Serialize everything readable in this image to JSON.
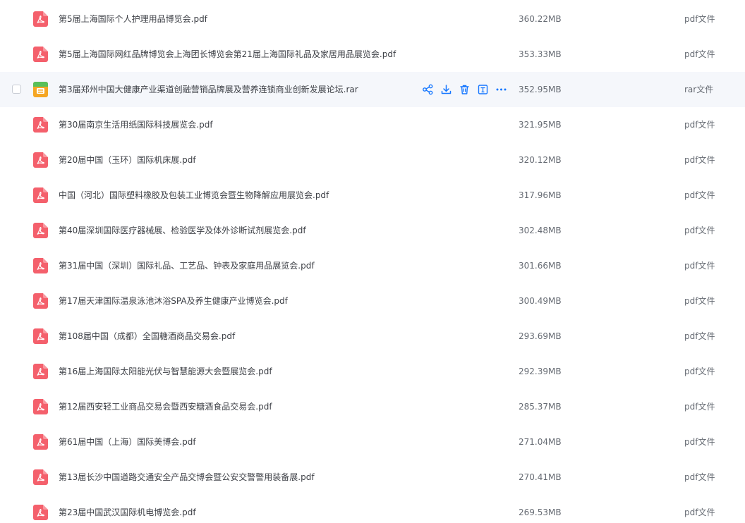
{
  "colors": {
    "pdf_icon": "#f4606c",
    "rar_icon": "#f5a623",
    "rar_icon_accent": "#58c05a",
    "action_icon": "#1677ff",
    "hover_row": "#f5f7fb"
  },
  "hovered_row_index": 2,
  "hover_actions": [
    {
      "name": "share-icon"
    },
    {
      "name": "download-icon"
    },
    {
      "name": "delete-icon"
    },
    {
      "name": "preview-icon"
    },
    {
      "name": "more-icon"
    }
  ],
  "files": [
    {
      "name": "第5届上海国际个人护理用品博览会.pdf",
      "size": "360.22MB",
      "type": "pdf文件",
      "icon": "pdf-icon"
    },
    {
      "name": "第5届上海国际网红品牌博览会上海团长博览会第21届上海国际礼品及家居用品展览会.pdf",
      "size": "353.33MB",
      "type": "pdf文件",
      "icon": "pdf-icon"
    },
    {
      "name": "第3届郑州中国大健康产业渠道创融营销品牌展及营养连锁商业创新发展论坛.rar",
      "size": "352.95MB",
      "type": "rar文件",
      "icon": "rar-icon"
    },
    {
      "name": "第30届南京生活用纸国际科技展览会.pdf",
      "size": "321.95MB",
      "type": "pdf文件",
      "icon": "pdf-icon"
    },
    {
      "name": "第20届中国（玉环）国际机床展.pdf",
      "size": "320.12MB",
      "type": "pdf文件",
      "icon": "pdf-icon"
    },
    {
      "name": "中国（河北）国际塑料橡胶及包装工业博览会暨生物降解应用展览会.pdf",
      "size": "317.96MB",
      "type": "pdf文件",
      "icon": "pdf-icon"
    },
    {
      "name": "第40届深圳国际医疗器械展、检验医学及体外诊断试剂展览会.pdf",
      "size": "302.48MB",
      "type": "pdf文件",
      "icon": "pdf-icon"
    },
    {
      "name": "第31届中国（深圳）国际礼品、工艺品、钟表及家庭用品展览会.pdf",
      "size": "301.66MB",
      "type": "pdf文件",
      "icon": "pdf-icon"
    },
    {
      "name": "第17届天津国际温泉泳池沐浴SPA及养生健康产业博览会.pdf",
      "size": "300.49MB",
      "type": "pdf文件",
      "icon": "pdf-icon"
    },
    {
      "name": "第108届中国（成都）全国糖酒商品交易会.pdf",
      "size": "293.69MB",
      "type": "pdf文件",
      "icon": "pdf-icon"
    },
    {
      "name": "第16届上海国际太阳能光伏与智慧能源大会暨展览会.pdf",
      "size": "292.39MB",
      "type": "pdf文件",
      "icon": "pdf-icon"
    },
    {
      "name": "第12届西安轻工业商品交易会暨西安糖酒食品交易会.pdf",
      "size": "285.37MB",
      "type": "pdf文件",
      "icon": "pdf-icon"
    },
    {
      "name": "第61届中国（上海）国际美博会.pdf",
      "size": "271.04MB",
      "type": "pdf文件",
      "icon": "pdf-icon"
    },
    {
      "name": "第13届长沙中国道路交通安全产品交博会暨公安交警警用装备展.pdf",
      "size": "270.41MB",
      "type": "pdf文件",
      "icon": "pdf-icon"
    },
    {
      "name": "第23届中国武汉国际机电博览会.pdf",
      "size": "269.53MB",
      "type": "pdf文件",
      "icon": "pdf-icon"
    }
  ]
}
